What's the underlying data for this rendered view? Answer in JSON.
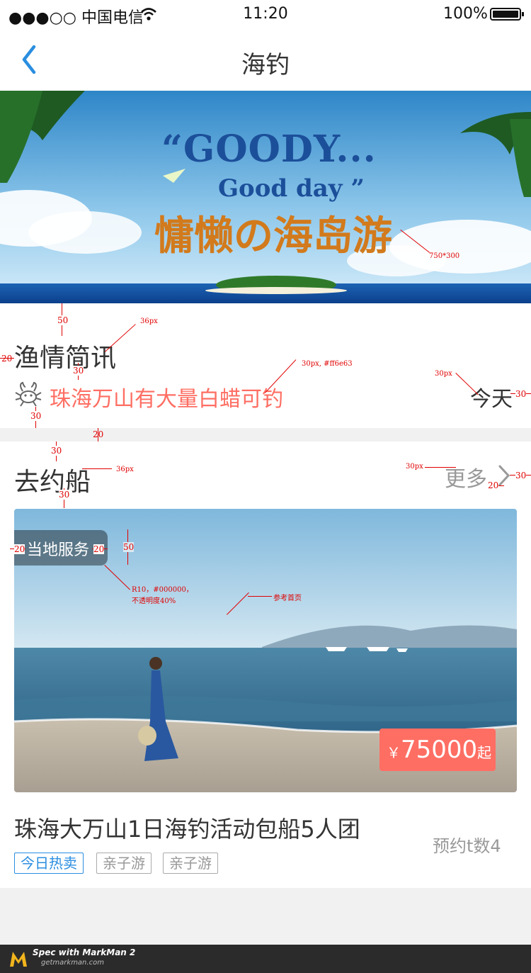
{
  "status_bar": {
    "carrier": "●●●○○ 中国电信",
    "time": "11:20",
    "battery": "100%"
  },
  "nav": {
    "title": "海钓"
  },
  "banner": {
    "line1": "“GOODY...",
    "line2": "Good day ”",
    "line3": "慵懒の海岛游",
    "note": "750*300"
  },
  "fishing_news": {
    "heading": "渔情简讯",
    "item_text": "珠海万山有大量白蜡可钓",
    "item_date": "今天"
  },
  "boats": {
    "heading": "去约船",
    "more": "更多",
    "badge": "当地服务",
    "price_symbol": "￥",
    "price": "75000",
    "price_suffix": "起",
    "title": "珠海大万山1日海钓活动包船5人团",
    "count": "预约t数4",
    "tags": [
      "今日热卖",
      "亲子游",
      "亲子游"
    ]
  },
  "annotations": {
    "n50a": "50",
    "px36a": "36px",
    "n20a": "20",
    "n30a": "30",
    "px30color": "30px, #ff6e63",
    "px30a": "30px",
    "n30b": "30",
    "n30c": "30",
    "n20b": "20",
    "n30d": "30",
    "px36b": "36px",
    "px30b": "30px",
    "n30e": "30",
    "n20c": "20",
    "n30f": "30",
    "n20d": "20",
    "n20e": "20",
    "n50b": "50",
    "r10a": "R10，#000000，",
    "r10b": "不透明度40%",
    "ref": "参考首页"
  },
  "markman": {
    "line1": "Spec with MarkMan 2",
    "line2": "getmarkman.com"
  },
  "colors": {
    "accent": "#ff6e63",
    "blue": "#2a8ee0",
    "price_bg": "#ff6e63"
  }
}
